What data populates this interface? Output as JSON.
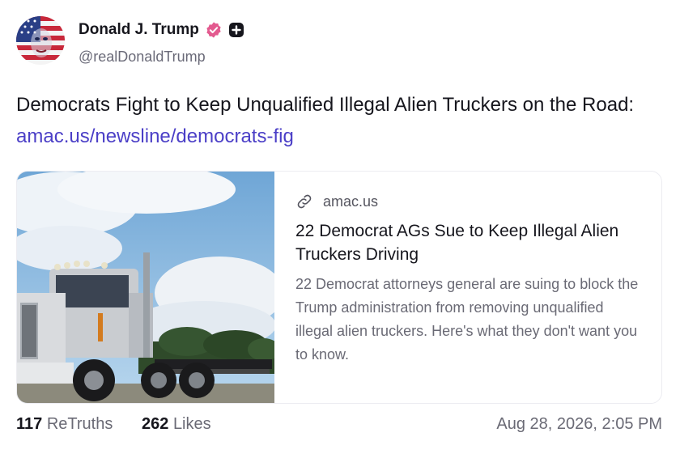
{
  "author": {
    "display_name": "Donald J. Trump",
    "handle": "@realDonaldTrump",
    "verified_color": "#e35a8f",
    "avatar_icon": "american-flag-portrait-avatar"
  },
  "post": {
    "text": "Democrats Fight to Keep Unqualified Illegal Alien Truckers on the Road: ",
    "link_text": "amac.us/newsline/democrats-fig",
    "link_color": "#4b3fc7"
  },
  "link_card": {
    "domain": "amac.us",
    "title": "22 Democrat AGs Sue to Keep Illegal Alien Truckers Driving",
    "description": "22 Democrat attorneys general are suing to block the Trump administration from removing unqualified illegal alien truckers. Here's what they don't want you to know.",
    "image_subject": "semi-truck-photo"
  },
  "footer": {
    "retruths_count": "117",
    "retruths_label": "ReTruths",
    "likes_count": "262",
    "likes_label": "Likes",
    "timestamp": "Aug 28, 2026, 2:05 PM"
  }
}
